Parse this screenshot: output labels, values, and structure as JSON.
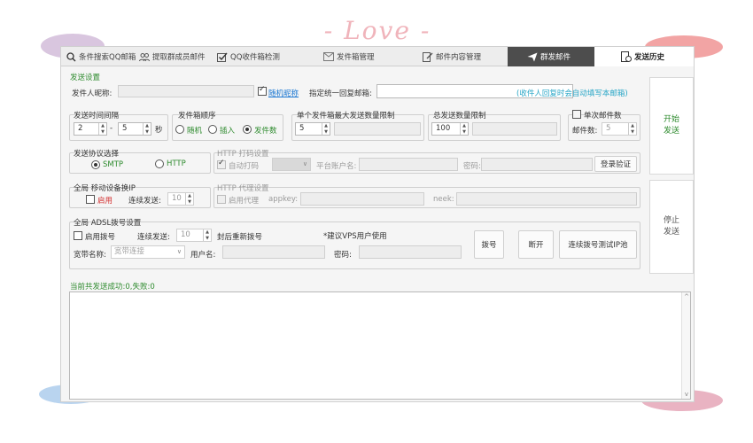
{
  "banner": {
    "title": "- Love -"
  },
  "tabs": [
    {
      "label": "条件搜索QQ邮箱",
      "icon": "search-icon"
    },
    {
      "label": "提取群成员邮件",
      "icon": "group-users-icon"
    },
    {
      "label": "QQ收件箱检测",
      "icon": "checkbox-icon"
    },
    {
      "label": "发件箱管理",
      "icon": "envelope-icon"
    },
    {
      "label": "邮件内容管理",
      "icon": "edit-document-icon"
    },
    {
      "label": "群发邮件",
      "icon": "paper-plane-icon"
    },
    {
      "label": "发送历史",
      "icon": "history-document-icon"
    }
  ],
  "send_settings": {
    "legend": "发送设置",
    "sender_nickname_label": "发件人昵称:",
    "sender_nickname_value": "",
    "random_nickname_label": "随机昵称",
    "random_nickname_checked": true,
    "reply_to_label": "指定统一回复邮箱:",
    "reply_to_value": "",
    "reply_hint": "(收件人回复时会自动填写本邮箱)"
  },
  "send_interval": {
    "legend": "发送时间间隔",
    "min": "2",
    "dash": "-",
    "max": "5",
    "unit": "秒"
  },
  "mailbox_order": {
    "legend": "发件箱顺序",
    "options": [
      "随机",
      "插入",
      "发件数"
    ],
    "selected": "发件数"
  },
  "per_mailbox_limit": {
    "legend": "单个发件箱最大发送数量限制",
    "value": "5",
    "extra": ""
  },
  "total_limit": {
    "legend": "总发送数量限制",
    "value": "100",
    "extra": ""
  },
  "single_count": {
    "label": "单次邮件数",
    "checked": false,
    "field_label": "邮件数:",
    "value": "5"
  },
  "protocol": {
    "legend": "发送协议选择",
    "options": [
      "SMTP",
      "HTTP"
    ],
    "selected": "SMTP"
  },
  "http_captcha": {
    "legend": "HTTP 打码设置",
    "auto_captcha_label": "自动打码",
    "auto_captcha_checked": true,
    "select_value": "",
    "platform_account_label": "平台账户名:",
    "password_label": "密码:",
    "login_button": "登录验证"
  },
  "mobile_ip": {
    "legend": "全局 移动设备换IP",
    "enable_label": "启用",
    "enable_checked": false,
    "continuous_label": "连续发送:",
    "continuous_value": "10"
  },
  "http_proxy": {
    "legend": "HTTP 代理设置",
    "enable_label": "启用代理",
    "appkey_label": "appkey:",
    "neek_label": "neek:"
  },
  "adsl": {
    "legend": "全局 ADSL拨号设置",
    "enable_label": "启用拨号",
    "enable_checked": false,
    "continuous_label": "连续发送:",
    "continuous_value": "10",
    "redial_label": "封后重新拨号",
    "vps_note": "*建议VPS用户使用",
    "broadband_label": "宽带名称:",
    "broadband_value": "宽带连接",
    "user_label": "用户名:",
    "password_label": "密码:",
    "dial_button": "拨号",
    "disconnect_button": "断开",
    "test_pool_button": "连续拨号测试IP池"
  },
  "actions": {
    "start": "开始发送",
    "stop": "停止发送"
  },
  "status": {
    "text": "当前共发送成功:0,失败:0"
  },
  "log": {
    "content": ""
  }
}
